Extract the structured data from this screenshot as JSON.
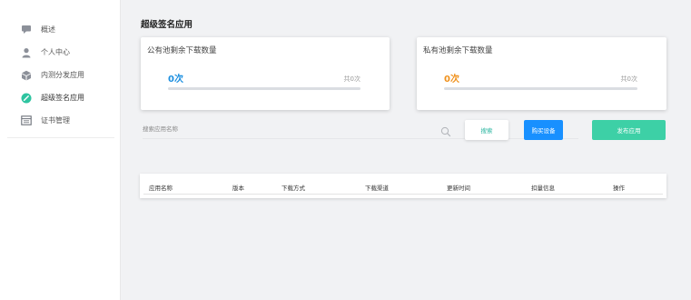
{
  "sidebar": {
    "items": [
      {
        "icon": "chat-bubble-icon",
        "label": "概述"
      },
      {
        "icon": "user-icon",
        "label": "个人中心"
      },
      {
        "icon": "box-icon",
        "label": "内测分发应用"
      },
      {
        "icon": "signature-icon",
        "label": "超级签名应用"
      },
      {
        "icon": "certificate-icon",
        "label": "证书管理"
      }
    ],
    "active_index": 3
  },
  "page": {
    "title": "超级签名应用"
  },
  "cards": {
    "public": {
      "title": "公有池剩余下载数量",
      "count": "0次",
      "total": "共0次",
      "progress": 0
    },
    "private": {
      "title": "私有池剩余下载数量",
      "count": "0次",
      "total": "共0次",
      "progress": 0
    }
  },
  "search": {
    "placeholder": "搜索应用名称",
    "value": ""
  },
  "buttons": {
    "search": "搜索",
    "buy": "购买设备",
    "publish": "发布应用"
  },
  "table": {
    "columns": [
      "应用名称",
      "版本",
      "下载方式",
      "下载渠道",
      "更新时间",
      "扣量信息",
      "操作"
    ],
    "rows": []
  },
  "colors": {
    "public_count": "#1e90e0",
    "private_count": "#f0921e",
    "primary": "#1890ff",
    "success": "#3dd0a6"
  }
}
